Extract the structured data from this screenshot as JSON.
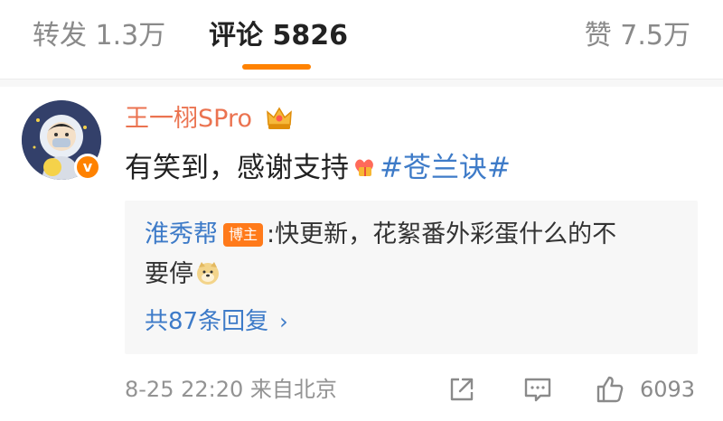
{
  "tabs": {
    "repost": "转发 1.3万",
    "comment": "评论 5826",
    "like": "赞 7.5万",
    "accent_color": "#ff8200"
  },
  "comment": {
    "username": "王一栩SPro",
    "username_color": "#eb7350",
    "text": "有笑到，感谢支持",
    "topic": "#苍兰诀#",
    "icons": [
      "crown-icon",
      "verified-icon",
      "heart-gift-emoji"
    ]
  },
  "reply": {
    "author": "淮秀帮",
    "badge": "博主",
    "colon": ":",
    "text_line1": "快更新，花絮番外彩蛋什么的不",
    "text_line2": "要停",
    "more": "共87条回复",
    "link_color": "#3e7bc8",
    "icons": [
      "doge-emoji",
      "chevron-right-icon"
    ]
  },
  "footer": {
    "time": "8-25 22:20",
    "source": "来自北京",
    "like_count": "6093",
    "icons": [
      "share-icon",
      "reply-icon",
      "thumbs-up-icon"
    ]
  }
}
